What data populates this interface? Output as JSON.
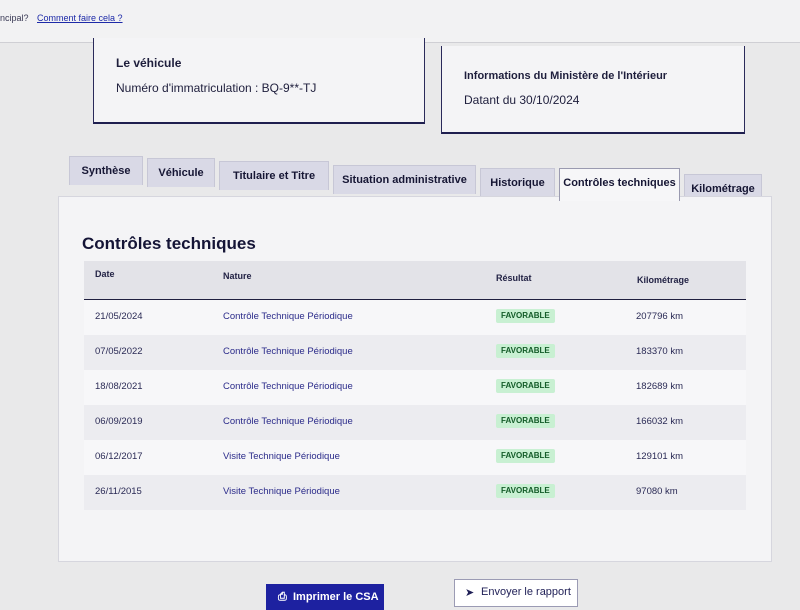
{
  "topbar": {
    "partial_question": "ncipal?",
    "how_link": "Comment faire cela ?"
  },
  "vehicle_box": {
    "title": "Le véhicule",
    "plate_label": "Numéro d'immatriculation : BQ-9**-TJ"
  },
  "ministry_box": {
    "title": "Informations du Ministère de l'Intérieur",
    "date_label": "Datant du 30/10/2024"
  },
  "tabs": [
    {
      "label": "Synthèse"
    },
    {
      "label": "Véhicule"
    },
    {
      "label": "Titulaire et Titre"
    },
    {
      "label": "Situation administrative"
    },
    {
      "label": "Historique"
    },
    {
      "label": "Contrôles techniques",
      "active": true
    },
    {
      "label": "Kilométrage"
    }
  ],
  "section": {
    "title": "Contrôles techniques",
    "columns": {
      "date": "Date",
      "nature": "Nature",
      "result": "Résultat",
      "mileage": "Kilométrage"
    },
    "rows": [
      {
        "date": "21/05/2024",
        "nature": "Contrôle Technique Périodique",
        "result": "FAVORABLE",
        "km": "207796 km"
      },
      {
        "date": "07/05/2022",
        "nature": "Contrôle Technique Périodique",
        "result": "FAVORABLE",
        "km": "183370 km"
      },
      {
        "date": "18/08/2021",
        "nature": "Contrôle Technique Périodique",
        "result": "FAVORABLE",
        "km": "182689 km"
      },
      {
        "date": "06/09/2019",
        "nature": "Contrôle Technique Périodique",
        "result": "FAVORABLE",
        "km": "166032 km"
      },
      {
        "date": "06/12/2017",
        "nature": "Visite Technique Périodique",
        "result": "FAVORABLE",
        "km": "129101 km"
      },
      {
        "date": "26/11/2015",
        "nature": "Visite Technique Périodique",
        "result": "FAVORABLE",
        "km": "97080 km"
      }
    ]
  },
  "buttons": {
    "print": "Imprimer le CSA",
    "send": "Envoyer le rapport"
  },
  "colors": {
    "primary_blue": "#1d21a0",
    "favorable_bg": "#c8f0d2",
    "favorable_text": "#135b28"
  }
}
